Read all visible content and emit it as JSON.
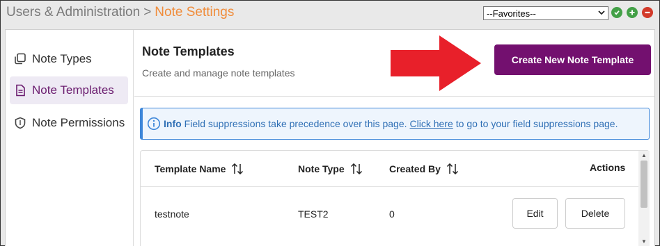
{
  "breadcrumb": {
    "parent": "Users & Administration",
    "separator": ">",
    "current": "Note Settings"
  },
  "favorites": {
    "selected": "--Favorites--"
  },
  "toolbar_icons": [
    "check-icon",
    "plus-icon",
    "minus-icon"
  ],
  "sidebar": {
    "items": [
      {
        "label": "Note Types",
        "icon": "copy-icon",
        "active": false
      },
      {
        "label": "Note Templates",
        "icon": "document-icon",
        "active": true
      },
      {
        "label": "Note Permissions",
        "icon": "shield-icon",
        "active": false
      }
    ]
  },
  "header": {
    "title": "Note Templates",
    "subtitle": "Create and manage note templates",
    "create_button": "Create New Note Template"
  },
  "info": {
    "label": "Info",
    "text": "Field suppressions take precedence over this page.",
    "link": "Click here",
    "text_after": "to go to your field suppressions page."
  },
  "table": {
    "columns": [
      "Template Name",
      "Note Type",
      "Created By",
      "Actions"
    ],
    "rows": [
      {
        "name": "testnote",
        "type": "TEST2",
        "created_by": "0",
        "edit": "Edit",
        "delete": "Delete"
      }
    ]
  },
  "colors": {
    "accent": "#73106f",
    "breadcrumb_current": "#f08c3a",
    "info_blue": "#3d86d9",
    "arrow_red": "#e8202a"
  }
}
